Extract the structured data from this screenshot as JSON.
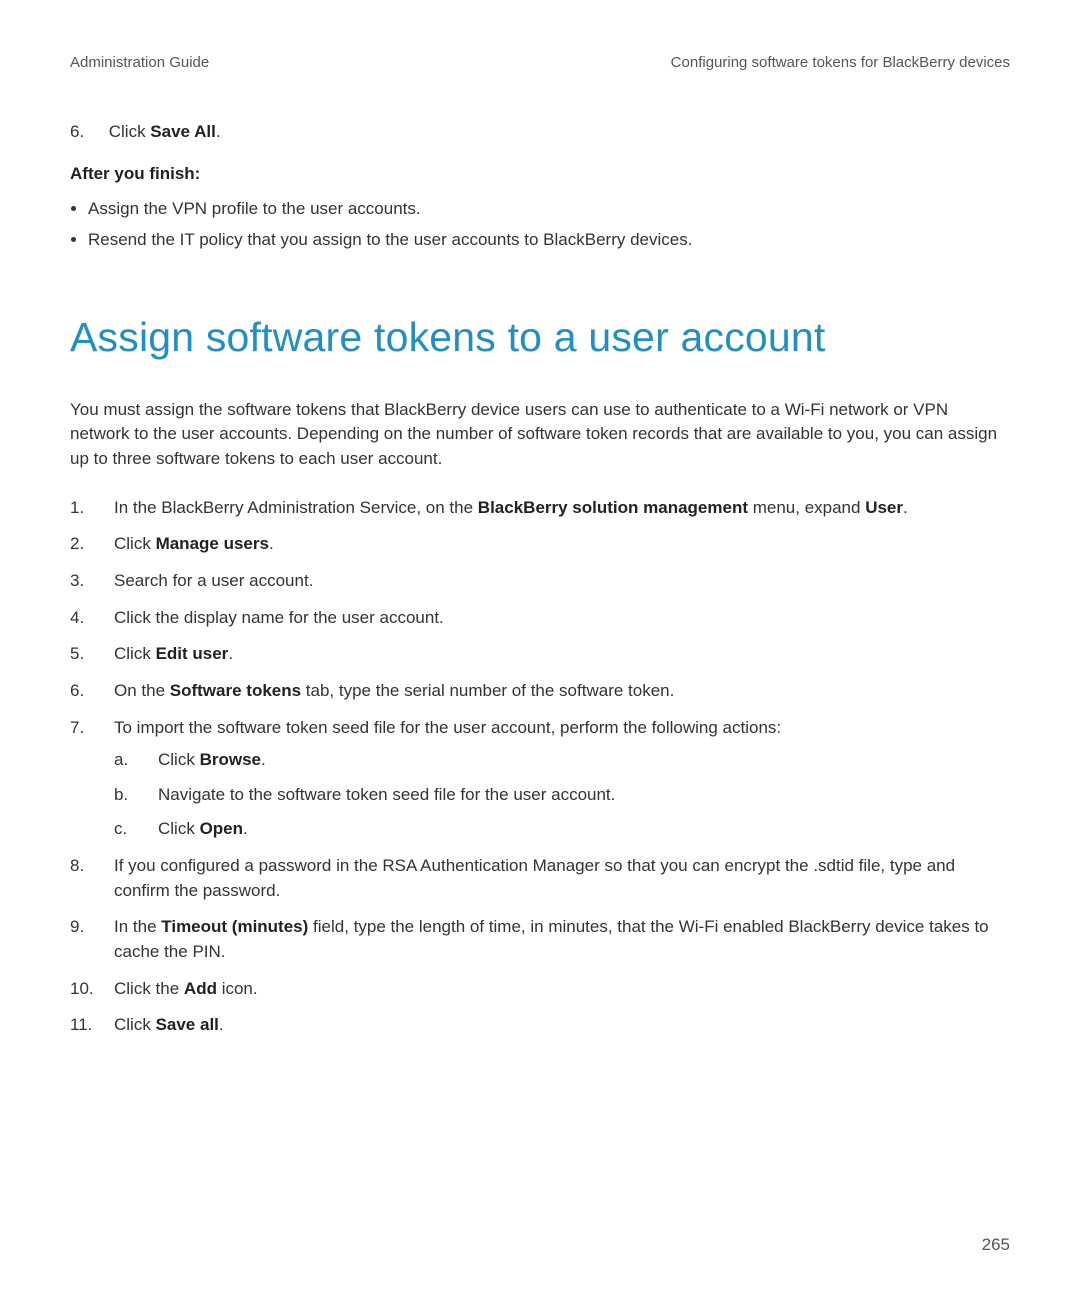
{
  "header": {
    "left": "Administration Guide",
    "right": "Configuring software tokens for BlackBerry devices"
  },
  "prev_step": {
    "num": "6.",
    "prefix": "Click ",
    "bold": "Save All",
    "suffix": "."
  },
  "after_finish_label": "After you finish:",
  "after_finish_items": [
    "Assign the VPN profile to the user accounts.",
    "Resend the IT policy that you assign to the user accounts to BlackBerry devices."
  ],
  "section_title": "Assign software tokens to a user account",
  "intro": "You must assign the software tokens that BlackBerry device users can use to authenticate to a Wi-Fi network or VPN network to the user accounts. Depending on the number of software token records that are available to you, you can assign up to three software tokens to each user account.",
  "steps": {
    "s1": {
      "a": "In the BlackBerry Administration Service, on the ",
      "b": "BlackBerry solution management",
      "c": " menu, expand ",
      "d": "User",
      "e": "."
    },
    "s2": {
      "a": "Click ",
      "b": "Manage users",
      "c": "."
    },
    "s3": {
      "a": "Search for a user account."
    },
    "s4": {
      "a": "Click the display name for the user account."
    },
    "s5": {
      "a": "Click ",
      "b": "Edit user",
      "c": "."
    },
    "s6": {
      "a": "On the ",
      "b": "Software tokens",
      "c": " tab, type the serial number of the software token."
    },
    "s7": {
      "a": "To import the software token seed file for the user account, perform the following actions:",
      "sub": {
        "a_marker": "a.",
        "a_1": "Click ",
        "a_b": "Browse",
        "a_2": ".",
        "b_marker": "b.",
        "b_1": "Navigate to the software token seed file for the user account.",
        "c_marker": "c.",
        "c_1": "Click ",
        "c_b": "Open",
        "c_2": "."
      }
    },
    "s8": {
      "a": "If you configured a password in the RSA Authentication Manager so that you can encrypt the .sdtid file, type and confirm the password."
    },
    "s9": {
      "a": "In the ",
      "b": "Timeout (minutes)",
      "c": " field, type the length of time, in minutes, that the Wi-Fi enabled BlackBerry device takes to cache the PIN."
    },
    "s10": {
      "a": "Click the ",
      "b": "Add",
      "c": " icon."
    },
    "s11": {
      "a": "Click ",
      "b": "Save all",
      "c": "."
    }
  },
  "page_number": "265"
}
